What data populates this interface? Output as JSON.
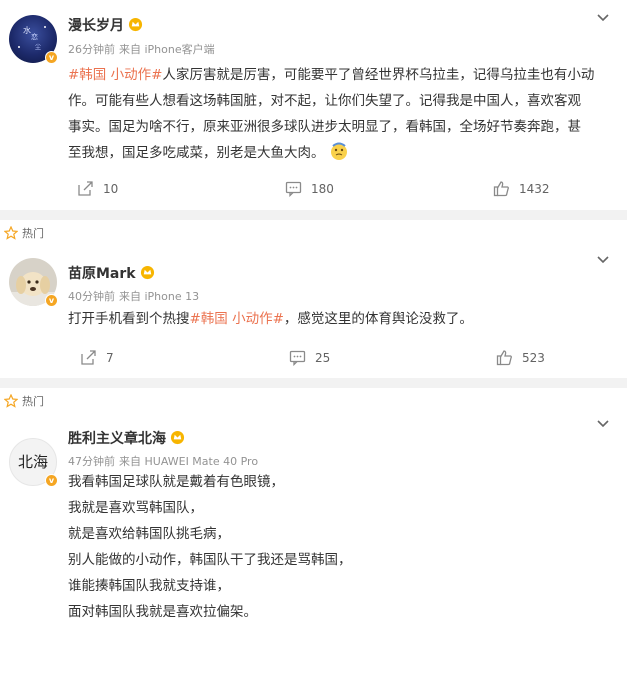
{
  "hot_label": "热门",
  "comments": [
    {
      "username": "漫长岁月",
      "time": "26分钟前",
      "source": "来自 iPhone客户端",
      "tag": "#韩国 小动作#",
      "lines": [
        "人家厉害就是厉害，可能要平了曾经世界杯乌拉圭，记得乌拉圭也有小动",
        "作。可能有些人想看这场韩国脏，对不起，让你们失望了。记得我是中国人，喜欢客观",
        "事实。国足为啥不行，原来亚洲很多球队进步太明显了，看韩国，全场好节奏奔跑，甚",
        "至我想，国足多吃咸菜，别老是大鱼大肉。"
      ],
      "emoji_name": "thinking-face-emoji",
      "shares": "10",
      "comments": "180",
      "likes": "1432"
    },
    {
      "username": "苗原Mark",
      "time": "40分钟前",
      "source": "来自 iPhone 13",
      "prefix": "打开手机看到个热搜",
      "tag": "#韩国 小动作#",
      "suffix": "，感觉这里的体育舆论没救了。",
      "shares": "7",
      "comments": "25",
      "likes": "523"
    },
    {
      "username": "胜利主义章北海",
      "avatar_text": "北海",
      "time": "47分钟前",
      "source": "来自 HUAWEI Mate 40 Pro",
      "lines": [
        "我看韩国足球队就是戴着有色眼镜，",
        "我就是喜欢骂韩国队，",
        "就是喜欢给韩国队挑毛病，",
        "别人能做的小动作，韩国队干了我还是骂韩国，",
        "谁能揍韩国队我就支持谁，",
        "面对韩国队我就是喜欢拉偏架。"
      ]
    }
  ],
  "colors": {
    "tag": "#eb7350",
    "badge": "#f5a623",
    "meta": "#939393"
  }
}
